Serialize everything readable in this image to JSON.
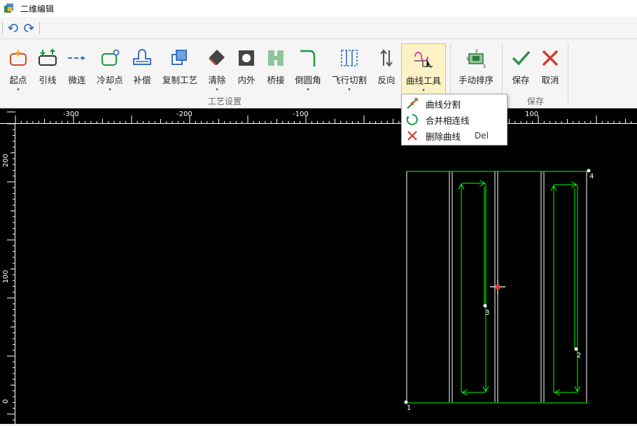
{
  "window": {
    "title": "二维编辑"
  },
  "ribbon": {
    "buttons": [
      {
        "id": "start",
        "label": "起点",
        "caret": "▾"
      },
      {
        "id": "lead",
        "label": "引线"
      },
      {
        "id": "micro",
        "label": "微连"
      },
      {
        "id": "cool",
        "label": "冷却点",
        "caret": "▾"
      },
      {
        "id": "comp",
        "label": "补偿"
      },
      {
        "id": "copy",
        "label": "复制工艺"
      },
      {
        "id": "clear",
        "label": "清除",
        "caret": "▾"
      },
      {
        "id": "inout",
        "label": "内外"
      },
      {
        "id": "bridge",
        "label": "桥接"
      },
      {
        "id": "fillet",
        "label": "倒圆角",
        "caret": "▾"
      },
      {
        "id": "fly",
        "label": "飞行切割",
        "caret": "▾"
      },
      {
        "id": "reverse",
        "label": "反向"
      },
      {
        "id": "curve",
        "label": "曲线工具",
        "caret": "▾"
      },
      {
        "id": "sort",
        "label": "手动排序"
      },
      {
        "id": "save",
        "label": "保存"
      },
      {
        "id": "cancel",
        "label": "取消"
      }
    ],
    "groups": {
      "process": "工艺设置",
      "save": "保存"
    }
  },
  "curve_menu": {
    "items": [
      {
        "label": "曲线分割",
        "shortcut": ""
      },
      {
        "label": "合并相连线",
        "shortcut": ""
      },
      {
        "label": "删除曲线",
        "shortcut": "Del"
      }
    ]
  },
  "ruler": {
    "top_labels": [
      "-300",
      "-200",
      "-100",
      "100"
    ],
    "left_labels": [
      "200",
      "100",
      "0"
    ]
  },
  "canvas": {
    "point_labels": [
      "1",
      "2",
      "3",
      "4"
    ],
    "colors": {
      "outline": "#ffffff",
      "path": "#00ff00",
      "cursor": "#ff3333"
    }
  }
}
